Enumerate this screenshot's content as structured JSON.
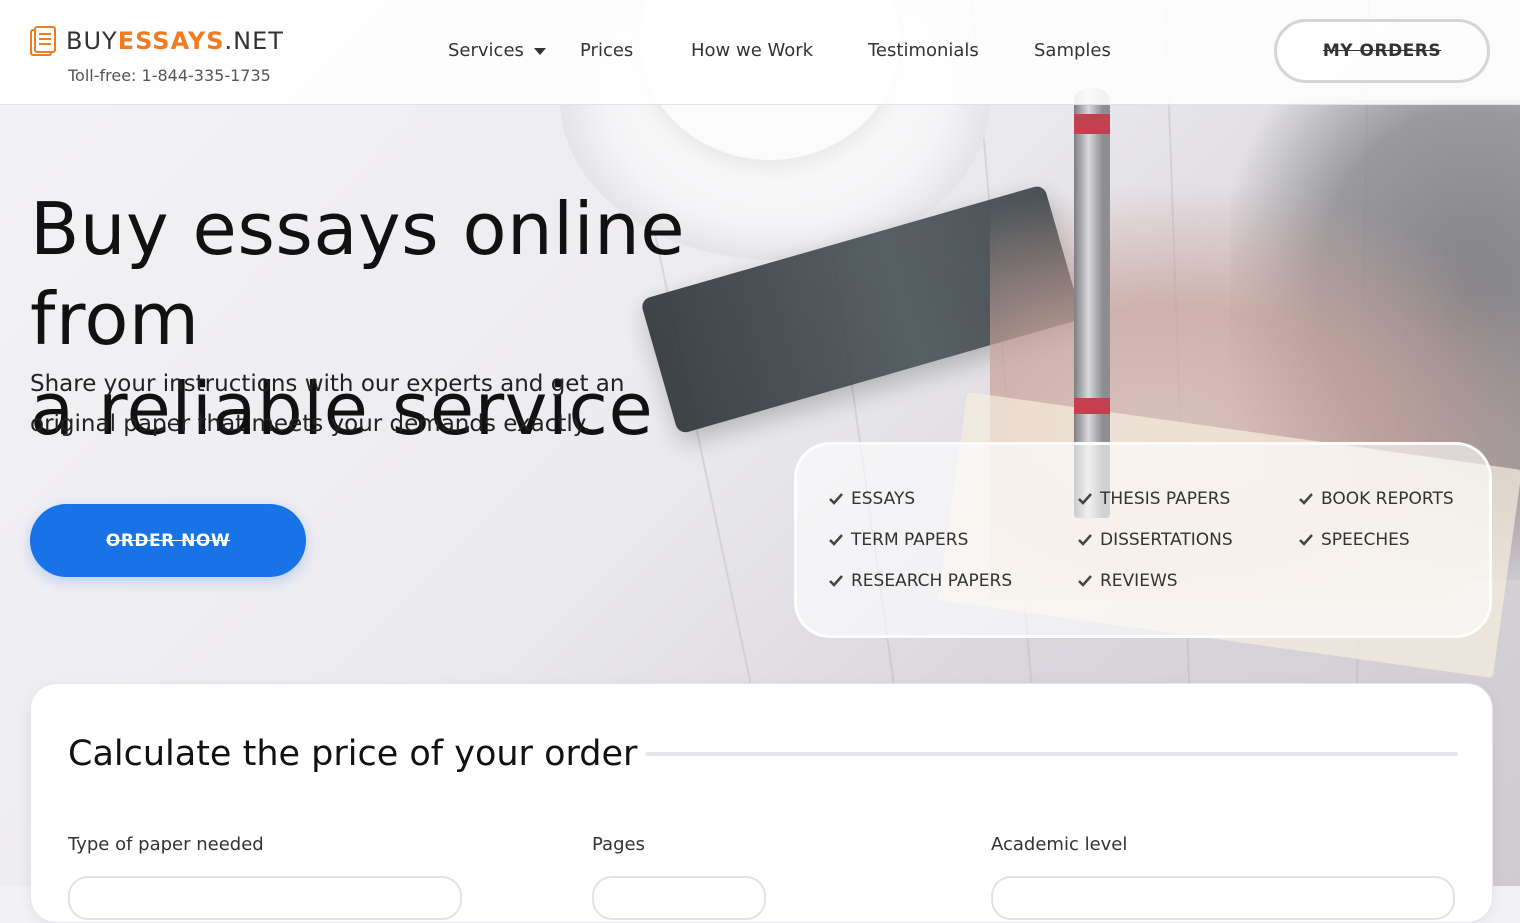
{
  "brand": {
    "name_plain": "BUY",
    "name_accent": "ESSAYS",
    "name_suffix": ".NET",
    "tollfree": "Toll-free: 1-844-335-1735",
    "accent_color": "#f07c22"
  },
  "nav": {
    "items": [
      {
        "label": "Services",
        "has_dropdown": true
      },
      {
        "label": "Prices"
      },
      {
        "label": "How we Work"
      },
      {
        "label": "Testimonials"
      },
      {
        "label": "Samples"
      }
    ],
    "my_orders": "MY ORDERS"
  },
  "hero": {
    "title_line1": "Buy essays online from",
    "title_line2": "a reliable service",
    "subtitle_line1": "Share your instructions with our experts and get an",
    "subtitle_line2": "original paper that meets your demands exactly.",
    "cta": "ORDER NOW",
    "cta_color": "#1773e6"
  },
  "services": [
    "ESSAYS",
    "TERM PAPERS",
    "RESEARCH PAPERS",
    "THESIS PAPERS",
    "DISSERTATIONS",
    "REVIEWS",
    "BOOK REPORTS",
    "SPEECHES"
  ],
  "calculator": {
    "title": "Calculate the price of your order",
    "fields": [
      {
        "label": "Type of paper needed"
      },
      {
        "label": "Pages"
      },
      {
        "label": "Academic level"
      }
    ]
  }
}
